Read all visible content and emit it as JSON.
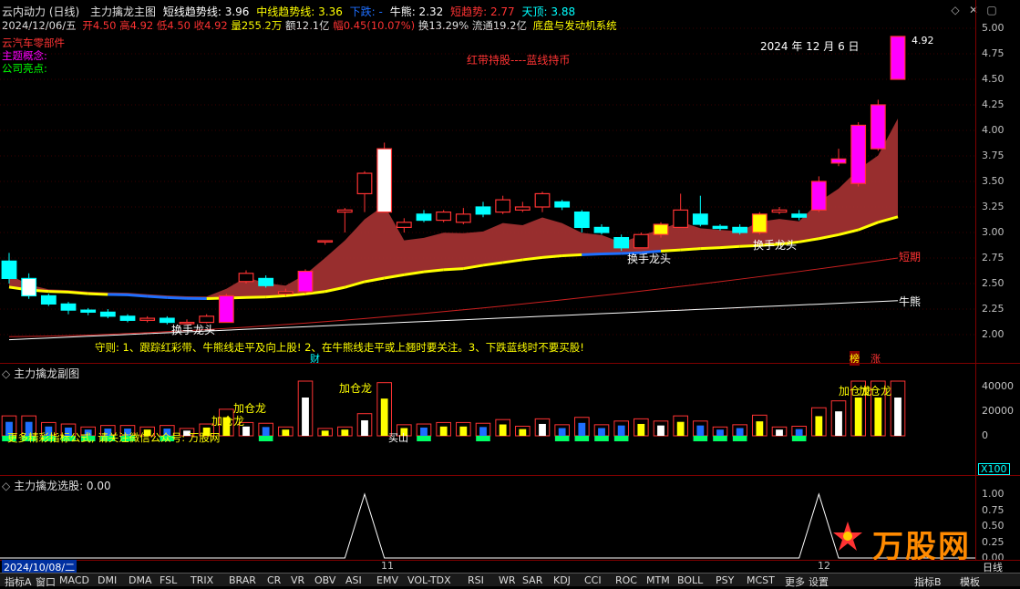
{
  "header": {
    "title": "云内动力 (日线)",
    "indicator": "主力擒龙主图",
    "short_trend": "短线趋势线: 3.96",
    "mid_trend": "中线趋势线: 3.36",
    "down": "下跌: -",
    "bull": "牛熊: 2.32",
    "short_momentum": "短趋势: 2.77",
    "top": "天顶: 3.88"
  },
  "info_row": {
    "date": "2024/12/06/五",
    "open": "开4.50",
    "high": "高4.92",
    "low": "低4.50",
    "close": "收4.92",
    "volume": "量255.2万",
    "amount": "额12.1亿",
    "change": "幅0.45(10.07%)",
    "turnover": "换13.29%",
    "float_cap": "流通19.2亿",
    "concept": "底盘与发动机系统"
  },
  "left_labels": {
    "sector": "云汽车零部件",
    "theme": "主题概念:",
    "highlight": "公司亮点:"
  },
  "main_chart": {
    "banner": "红带持股----蓝线持币",
    "date_label": "2024 年 12 月 6 日",
    "last_price": "4.92",
    "rule_text": "守则: 1、跟踪红彩带、牛熊线走平及向上股! 2、在牛熊线走平或上翘时要关注。3、下跌蓝线时不要买股!",
    "annotations": [
      "换手龙头",
      "换手龙头",
      "换手龙头"
    ],
    "label_short": "短期",
    "label_bull": "牛熊",
    "marker_cai": "财",
    "marker_bang": "榜",
    "marker_zhang": "涨",
    "price_scale": [
      "5.00",
      "4.75",
      "4.50",
      "4.25",
      "4.00",
      "3.75",
      "3.50",
      "3.25",
      "3.00",
      "2.75",
      "2.50",
      "2.25",
      "2.00"
    ],
    "scale_label": "日线"
  },
  "sub_chart": {
    "title": "主力擒龙副图",
    "labels": [
      "加仓龙",
      "加仓龙",
      "加仓龙",
      "加仓龙",
      "加仓龙"
    ],
    "notice": "更多精彩指标公式, 请关注微信公众号: 万股网",
    "marker_bu": "买山",
    "scale": [
      "40000",
      "20000",
      "0"
    ],
    "unit": "X100"
  },
  "select_chart": {
    "title": "主力擒龙选股: 0.00",
    "scale": [
      "1.00",
      "0.75",
      "0.50",
      "0.25",
      "0.00"
    ],
    "date_left": "2024/10/08/二",
    "date_mid": "11",
    "date_right": "12"
  },
  "watermark": "万股网",
  "bottom_tabs": [
    "指标A",
    "窗口",
    "MACD",
    "DMI",
    "DMA",
    "FSL",
    "TRIX",
    "BRAR",
    "CR",
    "VR",
    "OBV",
    "ASI",
    "EMV",
    "VOL-TDX",
    "RSI",
    "WR",
    "SAR",
    "KDJ",
    "CCI",
    "ROC",
    "MTM",
    "BOLL",
    "PSY",
    "MCST",
    "更多",
    "设置"
  ],
  "bottom_right": [
    "指标B",
    "模板"
  ],
  "colors": {
    "up": "#ff3333",
    "down": "#00ffff",
    "ribbon": "#a03030",
    "yellow": "#ffff00",
    "blue": "#1e6fff",
    "pink": "#ff00ff"
  },
  "chart_data": {
    "type": "candlestick",
    "price_ylim": [
      2.0,
      5.0
    ],
    "candles": [
      [
        2.72,
        2.55,
        2.8,
        2.5
      ],
      [
        2.55,
        2.38,
        2.6,
        2.35
      ],
      [
        2.38,
        2.3,
        2.4,
        2.28
      ],
      [
        2.3,
        2.24,
        2.32,
        2.2
      ],
      [
        2.24,
        2.22,
        2.26,
        2.19
      ],
      [
        2.22,
        2.18,
        2.25,
        2.16
      ],
      [
        2.18,
        2.14,
        2.2,
        2.12
      ],
      [
        2.14,
        2.16,
        2.18,
        2.12
      ],
      [
        2.16,
        2.12,
        2.18,
        2.1
      ],
      [
        2.12,
        2.12,
        2.15,
        2.1
      ],
      [
        2.12,
        2.18,
        2.2,
        2.11
      ],
      [
        2.12,
        2.38,
        2.4,
        2.12
      ],
      [
        2.52,
        2.6,
        2.63,
        2.5
      ],
      [
        2.55,
        2.48,
        2.58,
        2.46
      ],
      [
        2.4,
        2.42,
        2.45,
        2.38
      ],
      [
        2.42,
        2.62,
        2.64,
        2.4
      ],
      [
        2.92,
        2.92,
        2.92,
        2.88
      ],
      [
        3.2,
        3.22,
        3.24,
        3.0
      ],
      [
        3.38,
        3.58,
        3.6,
        3.2
      ],
      [
        3.2,
        3.82,
        3.88,
        3.2
      ],
      [
        3.05,
        3.1,
        3.14,
        3.0
      ],
      [
        3.18,
        3.12,
        3.22,
        3.1
      ],
      [
        3.12,
        3.2,
        3.22,
        3.1
      ],
      [
        3.1,
        3.18,
        3.24,
        3.08
      ],
      [
        3.25,
        3.18,
        3.3,
        3.15
      ],
      [
        3.2,
        3.32,
        3.36,
        3.18
      ],
      [
        3.22,
        3.25,
        3.3,
        3.2
      ],
      [
        3.25,
        3.38,
        3.4,
        3.2
      ],
      [
        3.3,
        3.25,
        3.32,
        3.22
      ],
      [
        3.2,
        3.05,
        3.22,
        3.0
      ],
      [
        3.05,
        3.0,
        3.08,
        2.98
      ],
      [
        2.95,
        2.85,
        2.98,
        2.82
      ],
      [
        2.85,
        2.98,
        3.0,
        2.85
      ],
      [
        2.98,
        3.08,
        3.1,
        2.95
      ],
      [
        3.05,
        3.22,
        3.38,
        3.05
      ],
      [
        3.18,
        3.08,
        3.36,
        3.06
      ],
      [
        3.06,
        3.04,
        3.08,
        3.02
      ],
      [
        3.05,
        3.0,
        3.08,
        2.98
      ],
      [
        3.0,
        3.18,
        3.2,
        2.98
      ],
      [
        3.2,
        3.22,
        3.25,
        3.18
      ],
      [
        3.18,
        3.15,
        3.22,
        3.12
      ],
      [
        3.22,
        3.5,
        3.55,
        3.2
      ],
      [
        3.68,
        3.72,
        3.82,
        3.65
      ],
      [
        3.48,
        4.05,
        4.08,
        3.45
      ],
      [
        3.82,
        4.25,
        4.3,
        3.8
      ],
      [
        4.5,
        4.92,
        4.92,
        4.5
      ]
    ]
  }
}
